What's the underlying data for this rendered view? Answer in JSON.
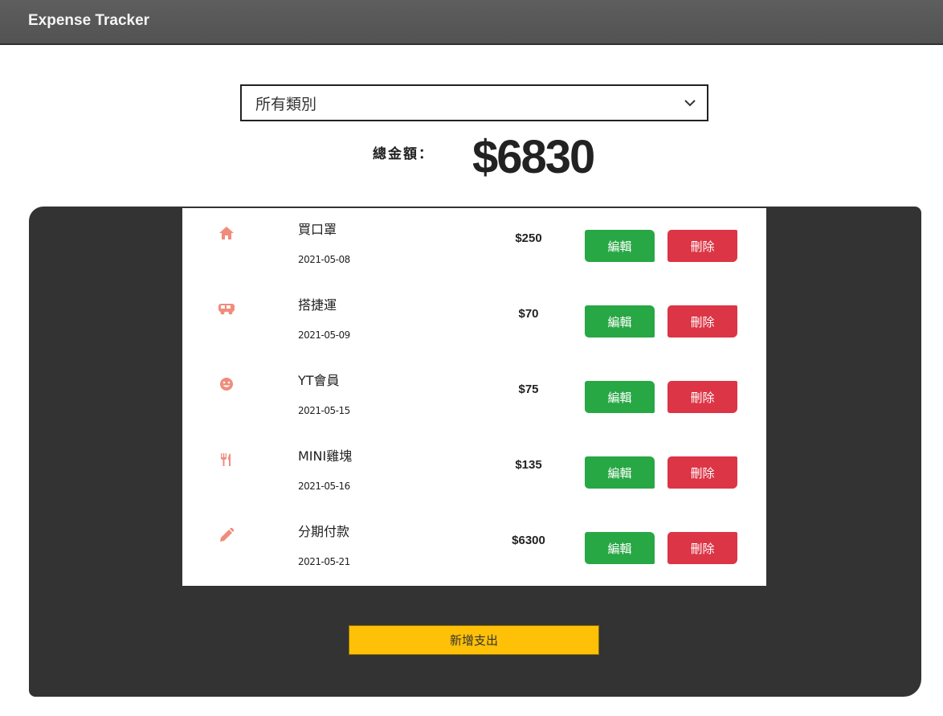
{
  "app": {
    "title": "Expense Tracker"
  },
  "filter": {
    "selected": "所有類別"
  },
  "total": {
    "label": "總金額：",
    "value": "$6830"
  },
  "colors": {
    "icon": "#f08c7c",
    "edit": "#28a745",
    "delete": "#dc3545",
    "add": "#ffc107",
    "panel": "#333333"
  },
  "records": [
    {
      "icon": "home-icon",
      "name": "買口罩",
      "date": "2021-05-08",
      "amount": "$250",
      "edit_label": "編輯",
      "delete_label": "刪除"
    },
    {
      "icon": "bus-icon",
      "name": "搭捷運",
      "date": "2021-05-09",
      "amount": "$70",
      "edit_label": "編輯",
      "delete_label": "刪除"
    },
    {
      "icon": "smile-icon",
      "name": "YT會員",
      "date": "2021-05-15",
      "amount": "$75",
      "edit_label": "編輯",
      "delete_label": "刪除"
    },
    {
      "icon": "utensils-icon",
      "name": "MINI雞塊",
      "date": "2021-05-16",
      "amount": "$135",
      "edit_label": "編輯",
      "delete_label": "刪除"
    },
    {
      "icon": "pencil-icon",
      "name": "分期付款",
      "date": "2021-05-21",
      "amount": "$6300",
      "edit_label": "編輯",
      "delete_label": "刪除"
    }
  ],
  "add_button": {
    "label": "新增支出"
  }
}
